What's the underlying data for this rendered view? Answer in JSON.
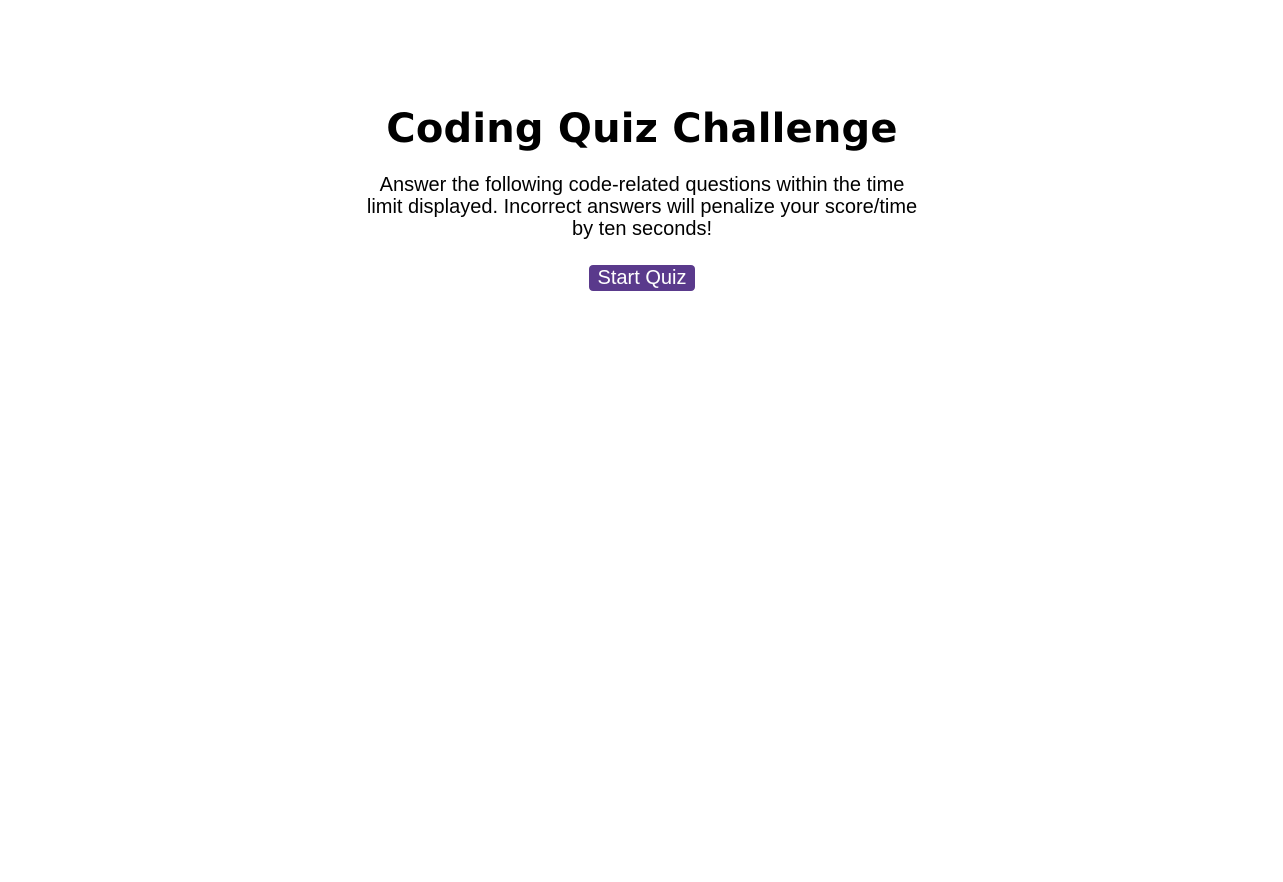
{
  "intro": {
    "title": "Coding Quiz Challenge",
    "description": "Answer the following code-related questions within the time limit displayed. Incorrect answers will penalize your score/time by ten seconds!",
    "start_label": "Start Quiz"
  },
  "colors": {
    "accent": "#5a3a8c",
    "accent_text": "#ffffff"
  }
}
